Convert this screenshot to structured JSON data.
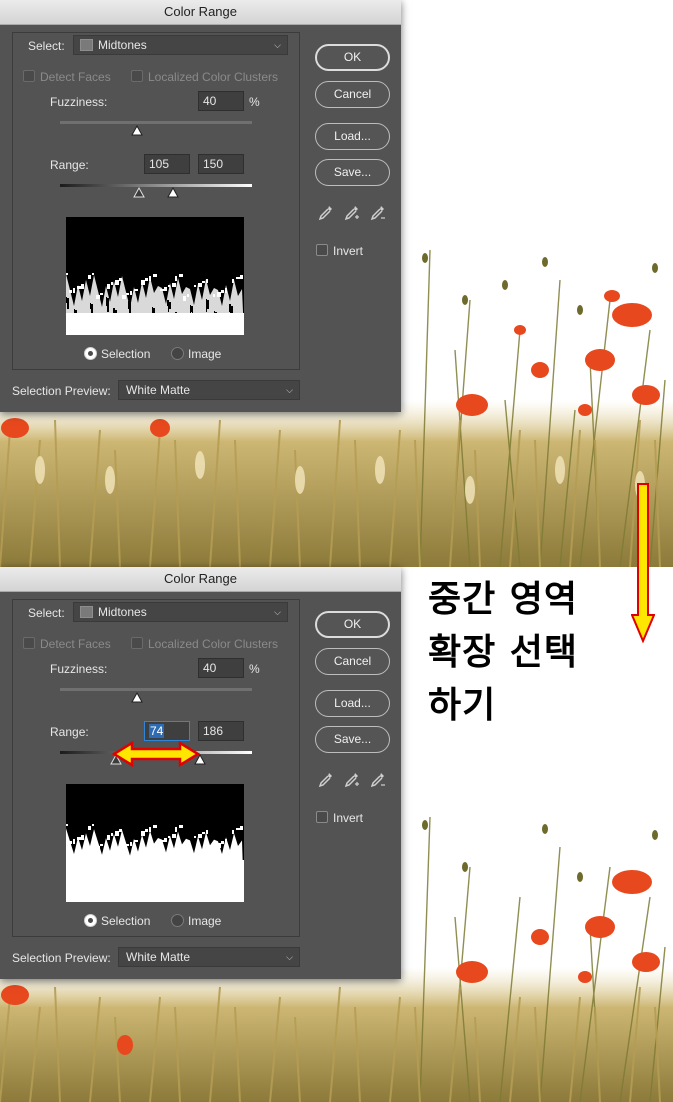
{
  "dialogs": [
    {
      "title": "Color Range",
      "select_label": "Select:",
      "select_value": "Midtones",
      "detect_faces_label": "Detect Faces",
      "localized_label": "Localized Color Clusters",
      "fuzziness_label": "Fuzziness:",
      "fuzziness_value": "40",
      "fuzziness_unit": "%",
      "range_label": "Range:",
      "range_low": "105",
      "range_high": "150",
      "range_low_level": 105,
      "range_high_level": 150,
      "selection_label": "Selection",
      "image_label": "Image",
      "preview_label": "Selection Preview:",
      "preview_value": "White Matte",
      "buttons": {
        "ok": "OK",
        "cancel": "Cancel",
        "load": "Load...",
        "save": "Save..."
      },
      "invert_label": "Invert"
    },
    {
      "title": "Color Range",
      "select_label": "Select:",
      "select_value": "Midtones",
      "detect_faces_label": "Detect Faces",
      "localized_label": "Localized Color Clusters",
      "fuzziness_label": "Fuzziness:",
      "fuzziness_value": "40",
      "fuzziness_unit": "%",
      "range_label": "Range:",
      "range_low": "74",
      "range_high": "186",
      "range_low_level": 74,
      "range_high_level": 186,
      "selection_label": "Selection",
      "image_label": "Image",
      "preview_label": "Selection Preview:",
      "preview_value": "White Matte",
      "buttons": {
        "ok": "OK",
        "cancel": "Cancel",
        "load": "Load...",
        "save": "Save..."
      },
      "invert_label": "Invert"
    }
  ],
  "caption": {
    "lines": [
      "중간 영역",
      "확장 선택",
      "하기"
    ]
  },
  "colors": {
    "accent_arrow_fill": "#ffe600",
    "accent_arrow_stroke": "#e10000",
    "dialog_bg": "#535353"
  },
  "icons": [
    "eyedropper-icon",
    "eyedropper-plus-icon",
    "eyedropper-minus-icon",
    "chevron-down-icon"
  ]
}
